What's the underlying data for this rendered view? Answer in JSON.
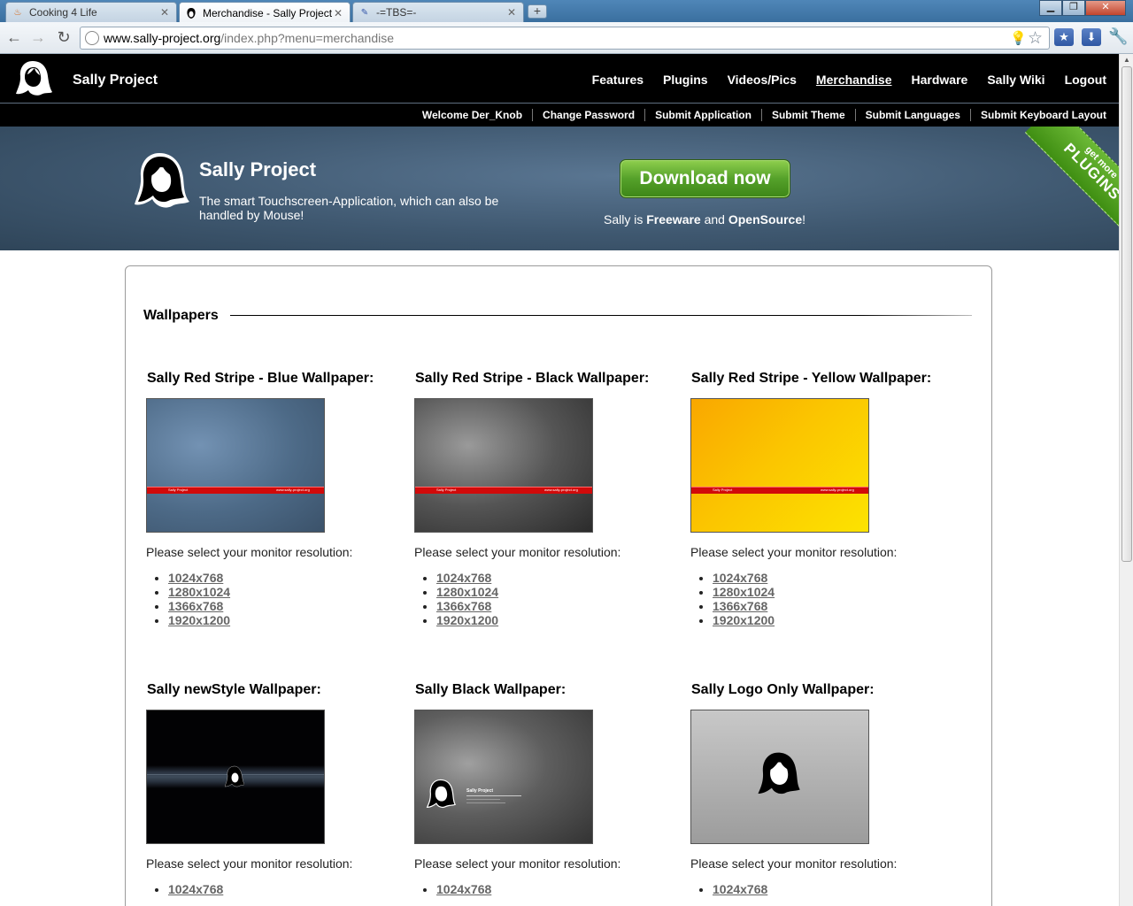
{
  "browser": {
    "tabs": [
      {
        "title": "Cooking 4 Life",
        "favicon": "cooking-favicon",
        "active": false
      },
      {
        "title": "Merchandise - Sally Project",
        "favicon": "sally-favicon",
        "active": true
      },
      {
        "title": "-=TBS=-",
        "favicon": "tbs-favicon",
        "active": false
      }
    ],
    "new_tab_label": "+",
    "url_host": "www.sally-project.org",
    "url_path": "/index.php?menu=merchandise"
  },
  "header": {
    "site_title": "Sally Project",
    "main_nav": [
      "Features",
      "Plugins",
      "Videos/Pics",
      "Merchandise",
      "Hardware",
      "Sally Wiki",
      "Logout"
    ],
    "current_nav": "Merchandise",
    "sub_nav": [
      "Welcome Der_Knob",
      "Change Password",
      "Submit Application",
      "Submit Theme",
      "Submit Languages",
      "Submit Keyboard Layout"
    ]
  },
  "banner": {
    "title": "Sally Project",
    "subtitle": "The smart Touchscreen-Application, which can also be handled by Mouse!",
    "download_label": "Download now",
    "freeware_prefix": "Sally is ",
    "freeware_word": "Freeware",
    "freeware_and": " and ",
    "opensource_word": "OpenSource",
    "freeware_suffix": "!",
    "ribbon_small": "get more",
    "ribbon_big": "PLUGINS"
  },
  "content": {
    "section_title": "Wallpapers",
    "prompt": "Please select your monitor resolution:",
    "resolutions": [
      "1024x768",
      "1280x1024",
      "1366x768",
      "1920x1200"
    ],
    "stripe_left": "Sally Project",
    "stripe_right": "www.sally-project.org",
    "mini_title": "Sally Project",
    "wallpapers": [
      {
        "title": "Sally Red Stripe - Blue Wallpaper:"
      },
      {
        "title": "Sally Red Stripe - Black Wallpaper:"
      },
      {
        "title": "Sally Red Stripe - Yellow Wallpaper:"
      },
      {
        "title": "Sally newStyle Wallpaper:"
      },
      {
        "title": "Sally Black Wallpaper:"
      },
      {
        "title": "Sally Logo Only Wallpaper:"
      }
    ]
  },
  "colors": {
    "nav_bg": "#000000",
    "banner_bg": "#3f5870",
    "download_green": "#55a12a",
    "stripe_red": "#d10a0a",
    "link_gray": "#666666"
  }
}
